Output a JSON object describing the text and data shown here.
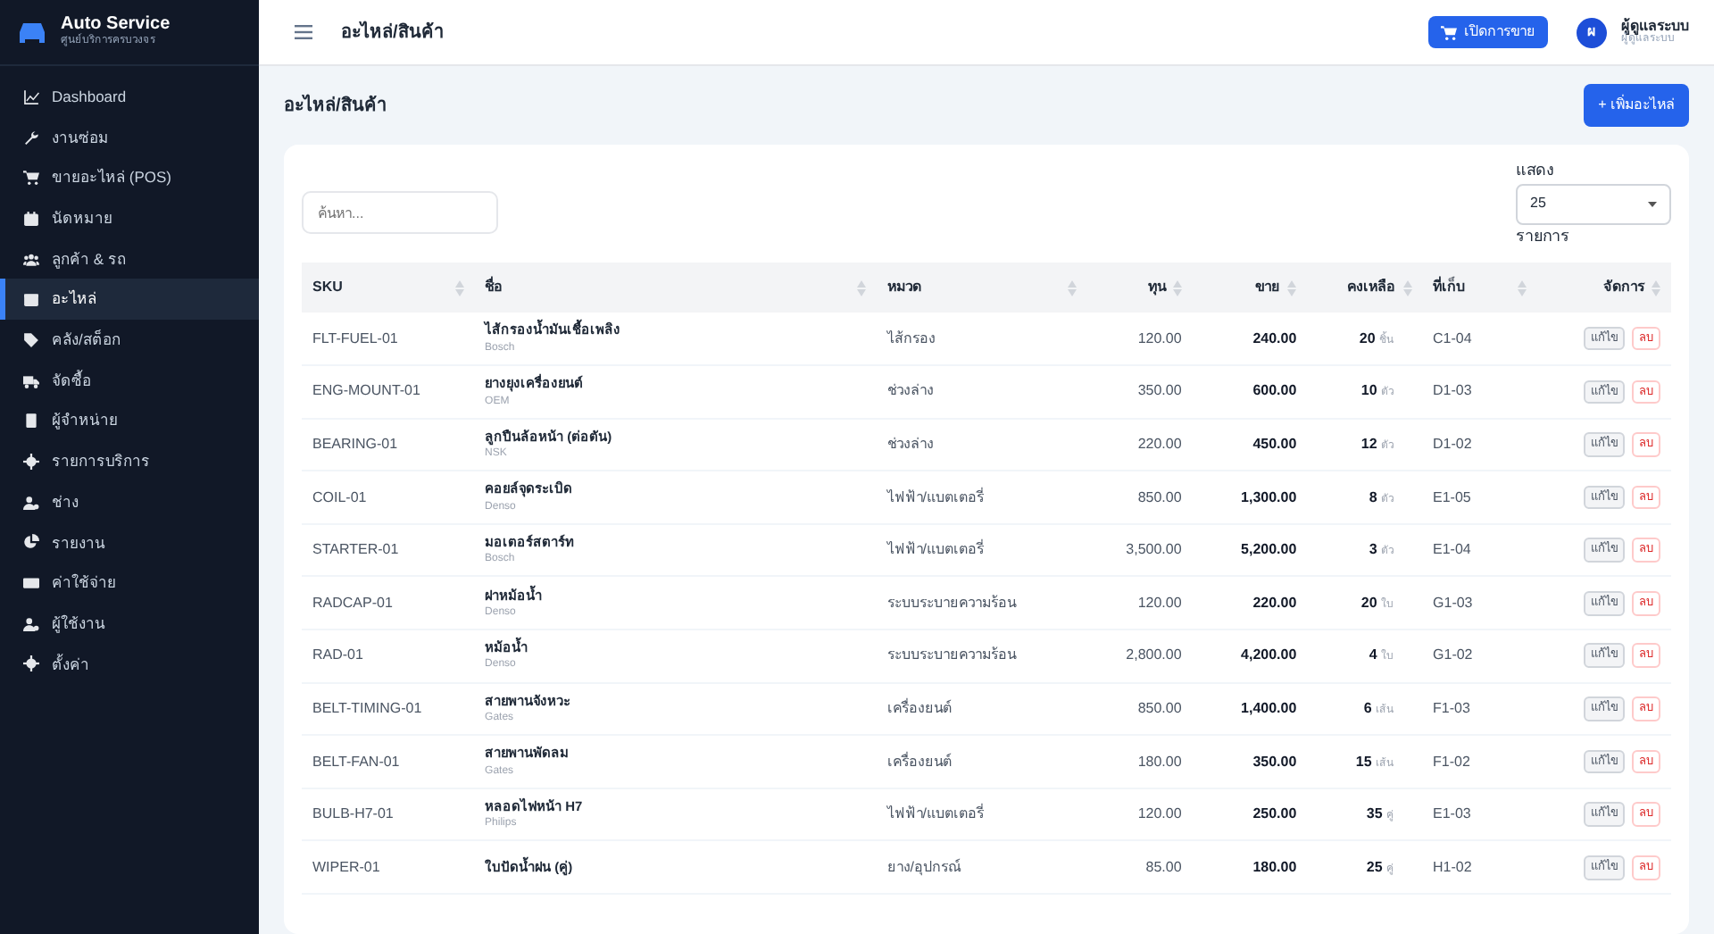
{
  "brand": {
    "title": "Auto Service",
    "subtitle": "ศูนย์บริการครบวงจร"
  },
  "sidebar": {
    "items": [
      {
        "label": "Dashboard",
        "selected": false
      },
      {
        "label": "งานซ่อม",
        "selected": false
      },
      {
        "label": "ขายอะไหล่ (POS)",
        "selected": false
      },
      {
        "label": "นัดหมาย",
        "selected": false
      },
      {
        "label": "ลูกค้า & รถ",
        "selected": false
      },
      {
        "label": "อะไหล่",
        "selected": true
      },
      {
        "label": "คลัง/สต็อก",
        "selected": false
      },
      {
        "label": "จัดซื้อ",
        "selected": false
      },
      {
        "label": "ผู้จำหน่าย",
        "selected": false
      },
      {
        "label": "รายการบริการ",
        "selected": false
      },
      {
        "label": "ช่าง",
        "selected": false
      },
      {
        "label": "รายงาน",
        "selected": false
      },
      {
        "label": "ค่าใช้จ่าย",
        "selected": false
      },
      {
        "label": "ผู้ใช้งาน",
        "selected": false
      },
      {
        "label": "ตั้งค่า",
        "selected": false
      }
    ]
  },
  "topbar": {
    "title": "อะไหล่/สินค้า",
    "pos_button": "เปิดการขาย",
    "user": {
      "initial": "ผ",
      "name": "ผู้ดูแลระบบ",
      "role": "ผู้ดูแลระบบ"
    }
  },
  "page": {
    "title": "อะไหล่/สินค้า",
    "add_button": "+ เพิ่มอะไหล่"
  },
  "search": {
    "placeholder": "ค้นหา..."
  },
  "page_size": {
    "label_before": "แสดง",
    "value": "25",
    "label_after": "รายการ"
  },
  "table": {
    "columns": [
      {
        "label": "SKU"
      },
      {
        "label": "ชื่อ"
      },
      {
        "label": "หมวด"
      },
      {
        "label": "ทุน"
      },
      {
        "label": "ขาย"
      },
      {
        "label": "คงเหลือ"
      },
      {
        "label": "ที่เก็บ"
      },
      {
        "label": "จัดการ"
      }
    ],
    "rows": [
      {
        "sku": "FLT-FUEL-01",
        "name": "ไส้กรองน้ำมันเชื้อเพลิง",
        "brand": "Bosch",
        "category": "ไส้กรอง",
        "cost": "120.00",
        "price": "240.00",
        "qty": "20",
        "unit": "ชิ้น",
        "location": "C1-04",
        "edit": "แก้ไข",
        "delete": "ลบ"
      },
      {
        "sku": "ENG-MOUNT-01",
        "name": "ยางยุงเครื่องยนต์",
        "brand": "OEM",
        "category": "ช่วงล่าง",
        "cost": "350.00",
        "price": "600.00",
        "qty": "10",
        "unit": "ตัว",
        "location": "D1-03",
        "edit": "แก้ไข",
        "delete": "ลบ"
      },
      {
        "sku": "BEARING-01",
        "name": "ลูกปืนล้อหน้า (ต่อตัน)",
        "brand": "NSK",
        "category": "ช่วงล่าง",
        "cost": "220.00",
        "price": "450.00",
        "qty": "12",
        "unit": "ตัว",
        "location": "D1-02",
        "edit": "แก้ไข",
        "delete": "ลบ"
      },
      {
        "sku": "COIL-01",
        "name": "คอยล์จุดระเบิด",
        "brand": "Denso",
        "category": "ไฟฟ้า/แบตเตอรี่",
        "cost": "850.00",
        "price": "1,300.00",
        "qty": "8",
        "unit": "ตัว",
        "location": "E1-05",
        "edit": "แก้ไข",
        "delete": "ลบ"
      },
      {
        "sku": "STARTER-01",
        "name": "มอเตอร์สตาร์ท",
        "brand": "Bosch",
        "category": "ไฟฟ้า/แบตเตอรี่",
        "cost": "3,500.00",
        "price": "5,200.00",
        "qty": "3",
        "unit": "ตัว",
        "location": "E1-04",
        "edit": "แก้ไข",
        "delete": "ลบ"
      },
      {
        "sku": "RADCAP-01",
        "name": "ฝาหม้อน้ำ",
        "brand": "Denso",
        "category": "ระบบระบายความร้อน",
        "cost": "120.00",
        "price": "220.00",
        "qty": "20",
        "unit": "ใบ",
        "location": "G1-03",
        "edit": "แก้ไข",
        "delete": "ลบ"
      },
      {
        "sku": "RAD-01",
        "name": "หม้อน้ำ",
        "brand": "Denso",
        "category": "ระบบระบายความร้อน",
        "cost": "2,800.00",
        "price": "4,200.00",
        "qty": "4",
        "unit": "ใบ",
        "location": "G1-02",
        "edit": "แก้ไข",
        "delete": "ลบ"
      },
      {
        "sku": "BELT-TIMING-01",
        "name": "สายพานจังหวะ",
        "brand": "Gates",
        "category": "เครื่องยนต์",
        "cost": "850.00",
        "price": "1,400.00",
        "qty": "6",
        "unit": "เส้น",
        "location": "F1-03",
        "edit": "แก้ไข",
        "delete": "ลบ"
      },
      {
        "sku": "BELT-FAN-01",
        "name": "สายพานพัดลม",
        "brand": "Gates",
        "category": "เครื่องยนต์",
        "cost": "180.00",
        "price": "350.00",
        "qty": "15",
        "unit": "เส้น",
        "location": "F1-02",
        "edit": "แก้ไข",
        "delete": "ลบ"
      },
      {
        "sku": "BULB-H7-01",
        "name": "หลอดไฟหน้า H7",
        "brand": "Philips",
        "category": "ไฟฟ้า/แบตเตอรี่",
        "cost": "120.00",
        "price": "250.00",
        "qty": "35",
        "unit": "คู่",
        "location": "E1-03",
        "edit": "แก้ไข",
        "delete": "ลบ"
      },
      {
        "sku": "WIPER-01",
        "name": "ใบปัดน้ำฝน (คู่)",
        "category": "ยาง/อุปกรณ์",
        "cost": "85.00",
        "price": "180.00",
        "qty": "25",
        "unit": "คู่",
        "location": "H1-02",
        "edit": "แก้ไข",
        "delete": "ลบ"
      }
    ]
  }
}
